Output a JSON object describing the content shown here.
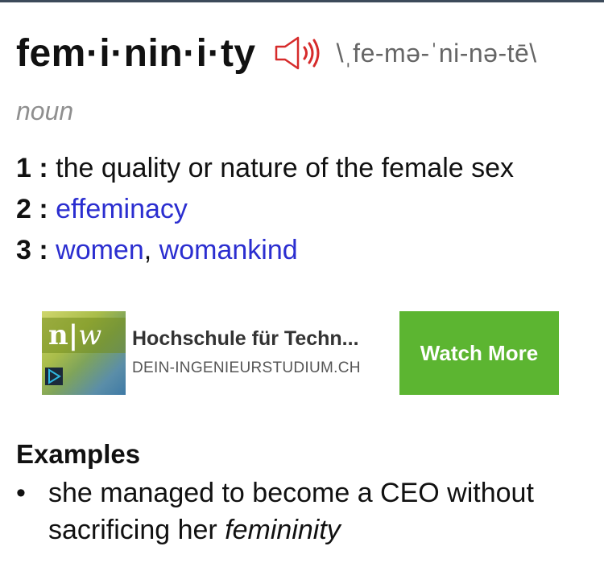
{
  "entry": {
    "headword": "fem·i·nin·i·ty",
    "pronunciation": "\\ˌfe-mə-ˈni-nə-tē\\",
    "part_of_speech": "noun",
    "speaker_icon": "speaker-icon"
  },
  "definitions": [
    {
      "num": "1",
      "sep": " : ",
      "text": "the quality or nature of the female sex"
    },
    {
      "num": "2",
      "sep": " : ",
      "link": "effeminacy"
    },
    {
      "num": "3",
      "sep": " : ",
      "link1": "women",
      "comma": ", ",
      "link2": "womankind"
    }
  ],
  "ad": {
    "logo_text_n": "n",
    "logo_text_sep": "|",
    "logo_text_w": "w",
    "title": "Hochschule für Techn...",
    "url": "DEIN-INGENIEURSTUDIUM.CH",
    "button_label": "Watch More",
    "button_color": "#5cb531",
    "play_icon": "play-icon"
  },
  "examples": {
    "heading": "Examples",
    "items": [
      {
        "bullet": "•",
        "text_before": "she managed to become a CEO without sacrificing her ",
        "italic": "femininity"
      }
    ]
  },
  "colors": {
    "link": "#2b2ed0",
    "speaker": "#d62b2b",
    "muted": "#8f8f8f"
  }
}
